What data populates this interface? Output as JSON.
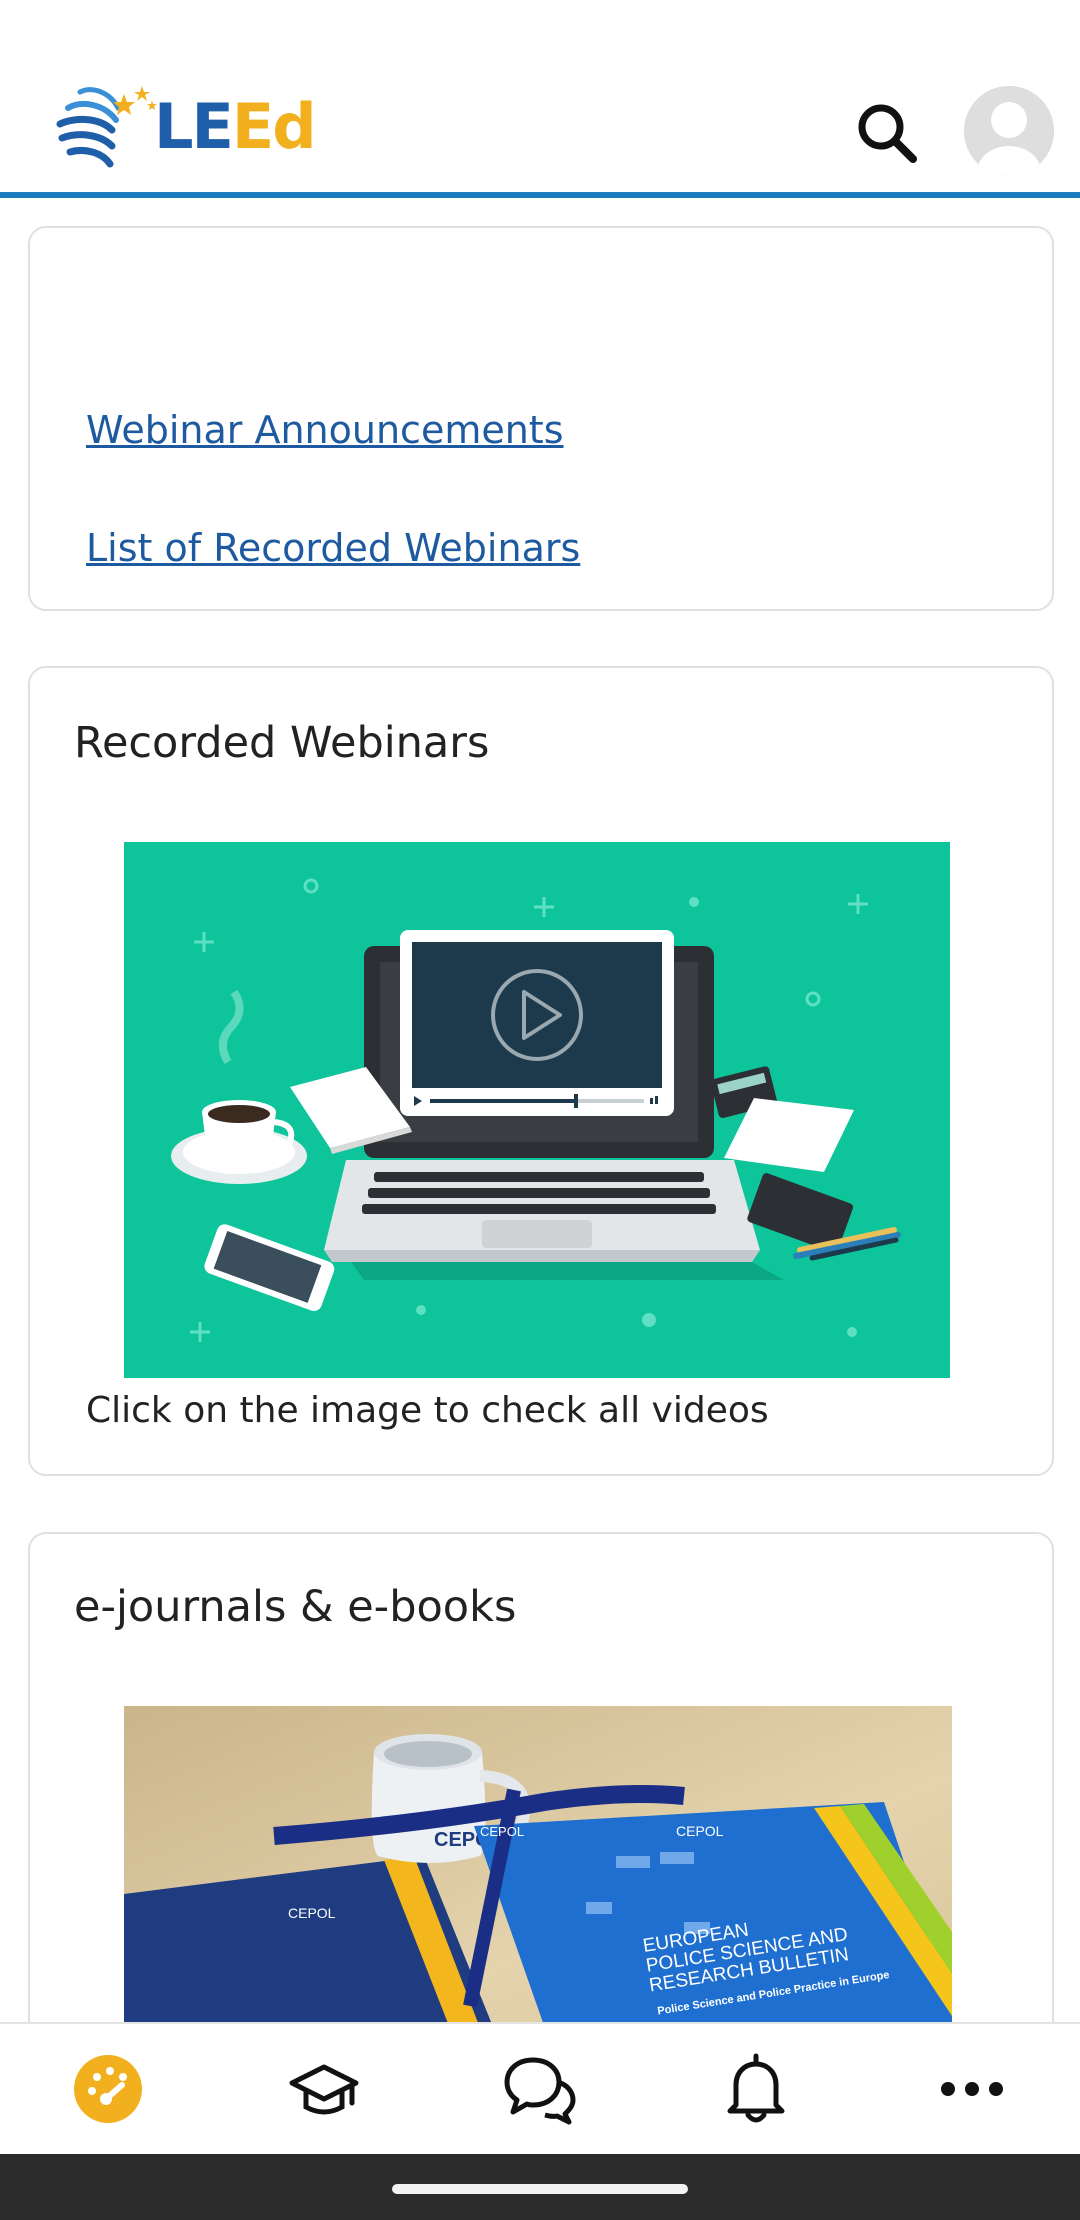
{
  "header": {
    "logo": {
      "text_le": "LE",
      "text_ed": "Ed",
      "icon": "leed-swirl-stars-logo"
    },
    "search_icon": "search-icon",
    "avatar_icon": "user-avatar-icon"
  },
  "links_card": {
    "link1": "Webinar Announcements",
    "link2": "List of Recorded Webinars"
  },
  "recorded_card": {
    "title": "Recorded Webinars",
    "caption": "Click on the image to check all videos",
    "image_icon": "laptop-video-illustration"
  },
  "journals_card": {
    "title": "e-journals & e-books",
    "image_icon": "cepol-publications-photo",
    "image_texts": {
      "mug": "CEPOL",
      "book_left": "CEPOL",
      "lanyard": "CEPOL",
      "bulletin_brand": "CEPOL",
      "bulletin_title_1": "EUROPEAN",
      "bulletin_title_2": "POLICE SCIENCE AND",
      "bulletin_title_3": "RESEARCH BULLETIN",
      "bulletin_subtitle": "Police Science and Police Practice in Europe"
    }
  },
  "bottom_nav": {
    "items": [
      {
        "icon": "dashboard-gauge-icon",
        "active": true
      },
      {
        "icon": "graduation-cap-icon",
        "active": false
      },
      {
        "icon": "chat-bubbles-icon",
        "active": false
      },
      {
        "icon": "bell-icon",
        "active": false
      },
      {
        "icon": "more-dots-icon",
        "active": false
      }
    ]
  },
  "colors": {
    "brand_blue": "#1f5ea8",
    "brand_yellow": "#f2b01e",
    "link_blue": "#1d5aa0",
    "header_rule": "#1a7bbf",
    "illustration_bg": "#0ec49a"
  }
}
